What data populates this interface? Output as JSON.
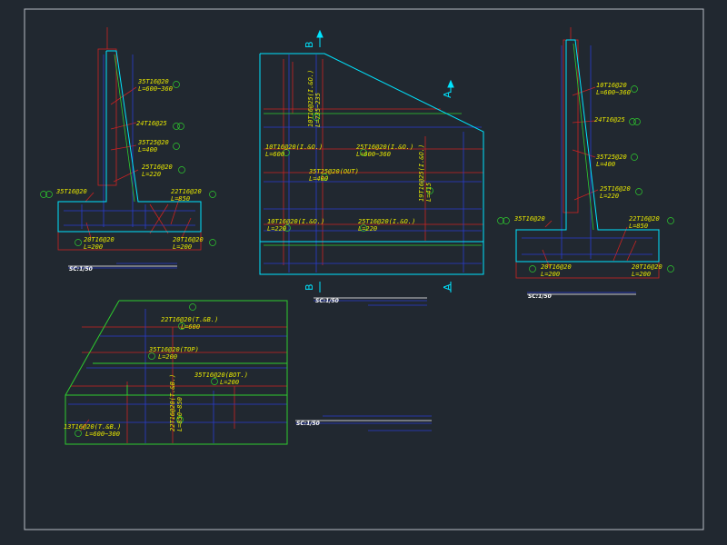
{
  "colors": {
    "background": "#212830",
    "frame": "#b8bcc4",
    "concrete": "#00e5ff",
    "rebar_green": "#2ecc2e",
    "rebar_blue": "#2a3bd0",
    "dimension_red": "#cc2222",
    "annotation": "#e6e600",
    "text_white": "#ffffff"
  },
  "section_left": {
    "labels": {
      "a": [
        "35T16@20",
        "L=600~360"
      ],
      "b": [
        "24T16@25"
      ],
      "c": [
        "35T25@20",
        "L=400"
      ],
      "d": [
        "25T16@20",
        "L=220"
      ],
      "e": [
        "35T16@20"
      ],
      "f": [
        "22T16@20",
        "L=850"
      ],
      "g": [
        "20T16@20",
        "L=200"
      ],
      "h": [
        "20T16@20",
        "L=200"
      ]
    },
    "scale": "SC:1/50"
  },
  "elevation": {
    "labels": {
      "vert_top": [
        "10T16@25(I.&O.)",
        "L=735~235"
      ],
      "h1": [
        "10T16@20(I.&O.)",
        "L=600"
      ],
      "h2": [
        "25T16@20(I.&O.)",
        "L=600~360"
      ],
      "h3": [
        "35T25@20(OUT)",
        "L=400"
      ],
      "vert_right": [
        "19T16@25(I.&O.)",
        "L=415"
      ],
      "h4": [
        "10T16@20(I.&O.)",
        "L=220"
      ],
      "h5": [
        "25T16@20(I.&O.)",
        "L=220"
      ]
    },
    "markers": {
      "a": "A",
      "b": "B"
    },
    "scale": "SC:1/50"
  },
  "section_right": {
    "labels": {
      "a": [
        "10T16@20",
        "L=600~360"
      ],
      "b": [
        "24T16@25"
      ],
      "c": [
        "35T25@20",
        "L=400"
      ],
      "d": [
        "25T16@20",
        "L=220"
      ],
      "e": [
        "35T16@20"
      ],
      "f": [
        "22T16@20",
        "L=850"
      ],
      "g": [
        "20T16@20",
        "L=200"
      ],
      "h": [
        "20T16@20",
        "L=200"
      ]
    },
    "scale": "SC:1/50"
  },
  "plan": {
    "labels": {
      "top": [
        "22T16@20(T.&B.)",
        "L=600"
      ],
      "mid": [
        "35T16@20(TOP)",
        "L=200"
      ],
      "bot": [
        "35T16@20(BOT.)",
        "L=200"
      ],
      "vert": [
        "22T16@20(T.&B.)",
        "L=850~850"
      ],
      "left": [
        "13T16@20(T.&B.)",
        "L=600~300"
      ]
    },
    "scale": "SC:1/50"
  }
}
